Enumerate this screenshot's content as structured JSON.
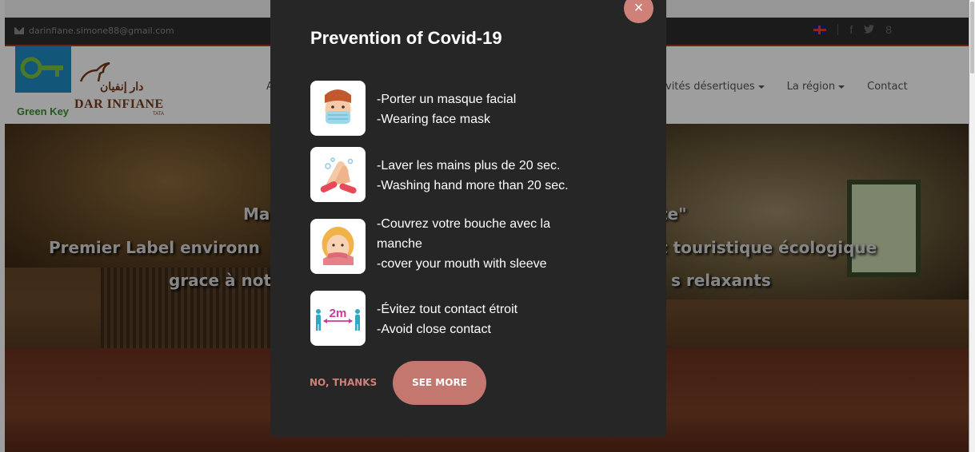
{
  "topbar": {
    "email": "darinfiane.simone88@gmail.com"
  },
  "social": {
    "flag": "uk-flag-icon",
    "facebook": "f",
    "twitter": "twitter-icon",
    "google": "8"
  },
  "logo": {
    "green_key": "Green Key",
    "arabic": "دار إنفيان",
    "name": "DAR INFIANE",
    "city": "TATA"
  },
  "nav": {
    "partial_left": "A",
    "desert": "vités désertiques",
    "region": "La région",
    "contact": "Contact"
  },
  "hero": {
    "line1_left": "Ma",
    "line1_right": "te\"",
    "line2_left": "Premier Label environn",
    "line2_right": "t touristique écologique",
    "line3_left": "grace à not",
    "line3_right": "s relaxants"
  },
  "modal": {
    "title": "Prevention of Covid-19",
    "close": "×",
    "items": [
      {
        "icon": "face-mask-icon",
        "lines": [
          "-Porter un masque facial",
          "-Wearing face mask"
        ]
      },
      {
        "icon": "hand-wash-icon",
        "lines": [
          "-Laver les mains plus de 20 sec.",
          "-Washing hand more than 20 sec."
        ]
      },
      {
        "icon": "cough-sleeve-icon",
        "lines": [
          "-Couvrez votre bouche avec la",
          "manche",
          "-cover your mouth with sleeve"
        ]
      },
      {
        "icon": "distance-icon",
        "lines": [
          "-Évitez tout contact étroit",
          "-Avoid close contact"
        ],
        "badge": "2m"
      }
    ],
    "no_thanks": "NO, THANKS",
    "see_more": "SEE MORE"
  },
  "colors": {
    "accent": "#c4776f",
    "modal_bg": "#262626",
    "topbar_bg": "#2d2d2d"
  }
}
